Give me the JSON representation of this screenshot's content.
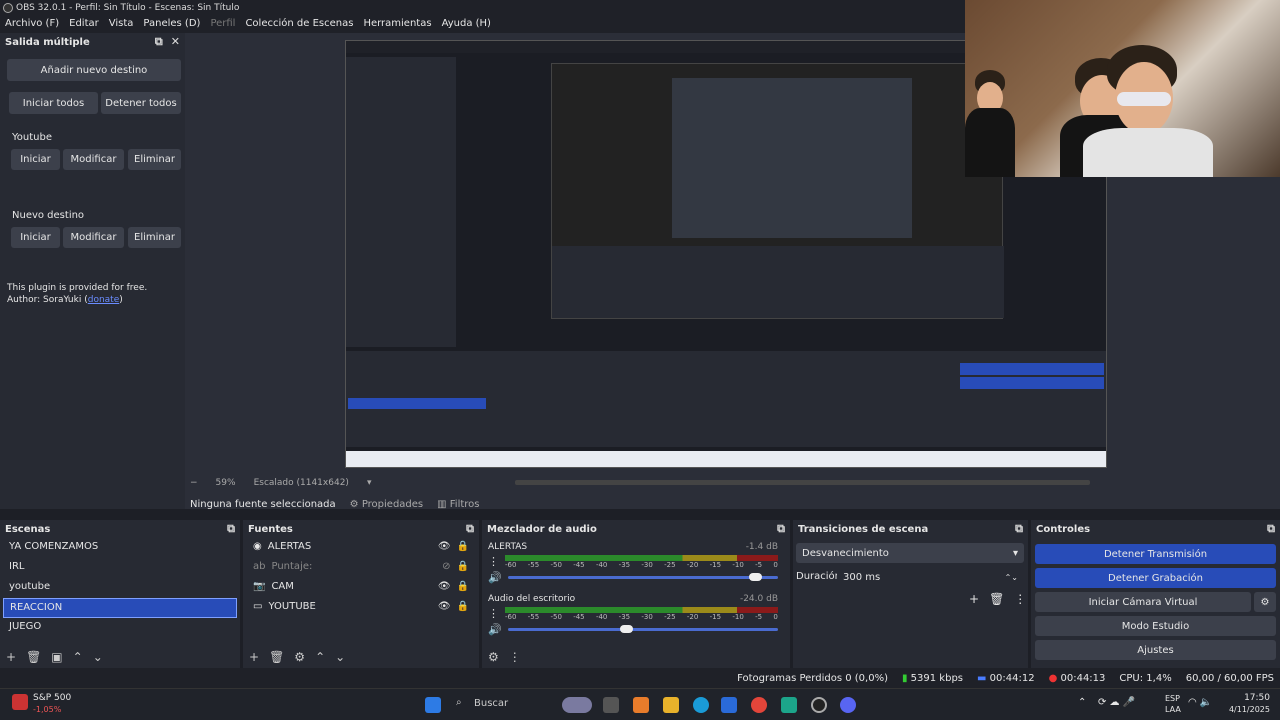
{
  "titlebar": {
    "title": "OBS 32.0.1 - Perfil: Sin Título - Escenas: Sin Título"
  },
  "menu": {
    "items": [
      "Archivo (F)",
      "Editar",
      "Vista",
      "Paneles (D)",
      "Perfil",
      "Colección de Escenas",
      "Herramientas",
      "Ayuda (H)"
    ]
  },
  "multi_output": {
    "title": "Salida múltiple",
    "add_destination": "Añadir nuevo destino",
    "start_all": "Iniciar todos",
    "stop_all": "Detener todos",
    "destinations": [
      {
        "name": "Youtube",
        "start": "Iniciar",
        "modify": "Modificar",
        "delete": "Eliminar"
      },
      {
        "name": "Nuevo destino",
        "start": "Iniciar",
        "modify": "Modificar",
        "delete": "Eliminar"
      }
    ],
    "plugin_note": "This plugin is provided for free.",
    "author_prefix": "Author: SoraYuki (",
    "donate": "donate",
    "author_suffix": ")"
  },
  "preview_bar": {
    "zoom": "59%",
    "scale": "Escalado (1141x642)"
  },
  "source_bar": {
    "no_source": "Ninguna fuente seleccionada",
    "properties": "Propiedades",
    "filters": "Filtros"
  },
  "scenes": {
    "title": "Escenas",
    "items": [
      "YA COMENZAMOS",
      "IRL",
      "youtube",
      "REACCION",
      "JUEGO"
    ],
    "selected_index": 3
  },
  "sources": {
    "title": "Fuentes",
    "items": [
      "ALERTAS",
      "Puntaje:",
      "CAM",
      "YOUTUBE"
    ]
  },
  "mixer": {
    "title": "Mezclador de audio",
    "channels": [
      {
        "name": "ALERTAS",
        "db": "-1.4 dB",
        "volume": 0.92
      },
      {
        "name": "Audio del escritorio",
        "db": "-24.0 dB",
        "volume": 0.44
      }
    ],
    "ticks": [
      "-60",
      "-55",
      "-50",
      "-45",
      "-40",
      "-35",
      "-30",
      "-25",
      "-20",
      "-15",
      "-10",
      "-5",
      "0"
    ]
  },
  "transitions": {
    "title": "Transiciones de escena",
    "selected": "Desvanecimiento",
    "duration_label": "Duración",
    "duration_value": "300 ms"
  },
  "controls": {
    "title": "Controles",
    "stop_stream": "Detener Transmisión",
    "stop_record": "Detener Grabación",
    "virtual_cam": "Iniciar Cámara Virtual",
    "studio_mode": "Modo Estudio",
    "settings": "Ajustes"
  },
  "status": {
    "dropped": "Fotogramas Perdidos 0 (0,0%)",
    "kbps": "5391 kbps",
    "stream_time": "00:44:12",
    "rec_time": "00:44:13",
    "cpu": "CPU: 1,4%",
    "fps": "60,00 / 60,00 FPS"
  },
  "taskbar": {
    "ticker_name": "S&P 500",
    "ticker_change": "-1,05%",
    "search": "Buscar",
    "lang1": "ESP",
    "lang2": "LAA",
    "time": "17:50",
    "date": "4/11/2025"
  },
  "colors": {
    "accent": "#284cb8",
    "panel": "#272a33",
    "bg": "#1d1f26"
  }
}
